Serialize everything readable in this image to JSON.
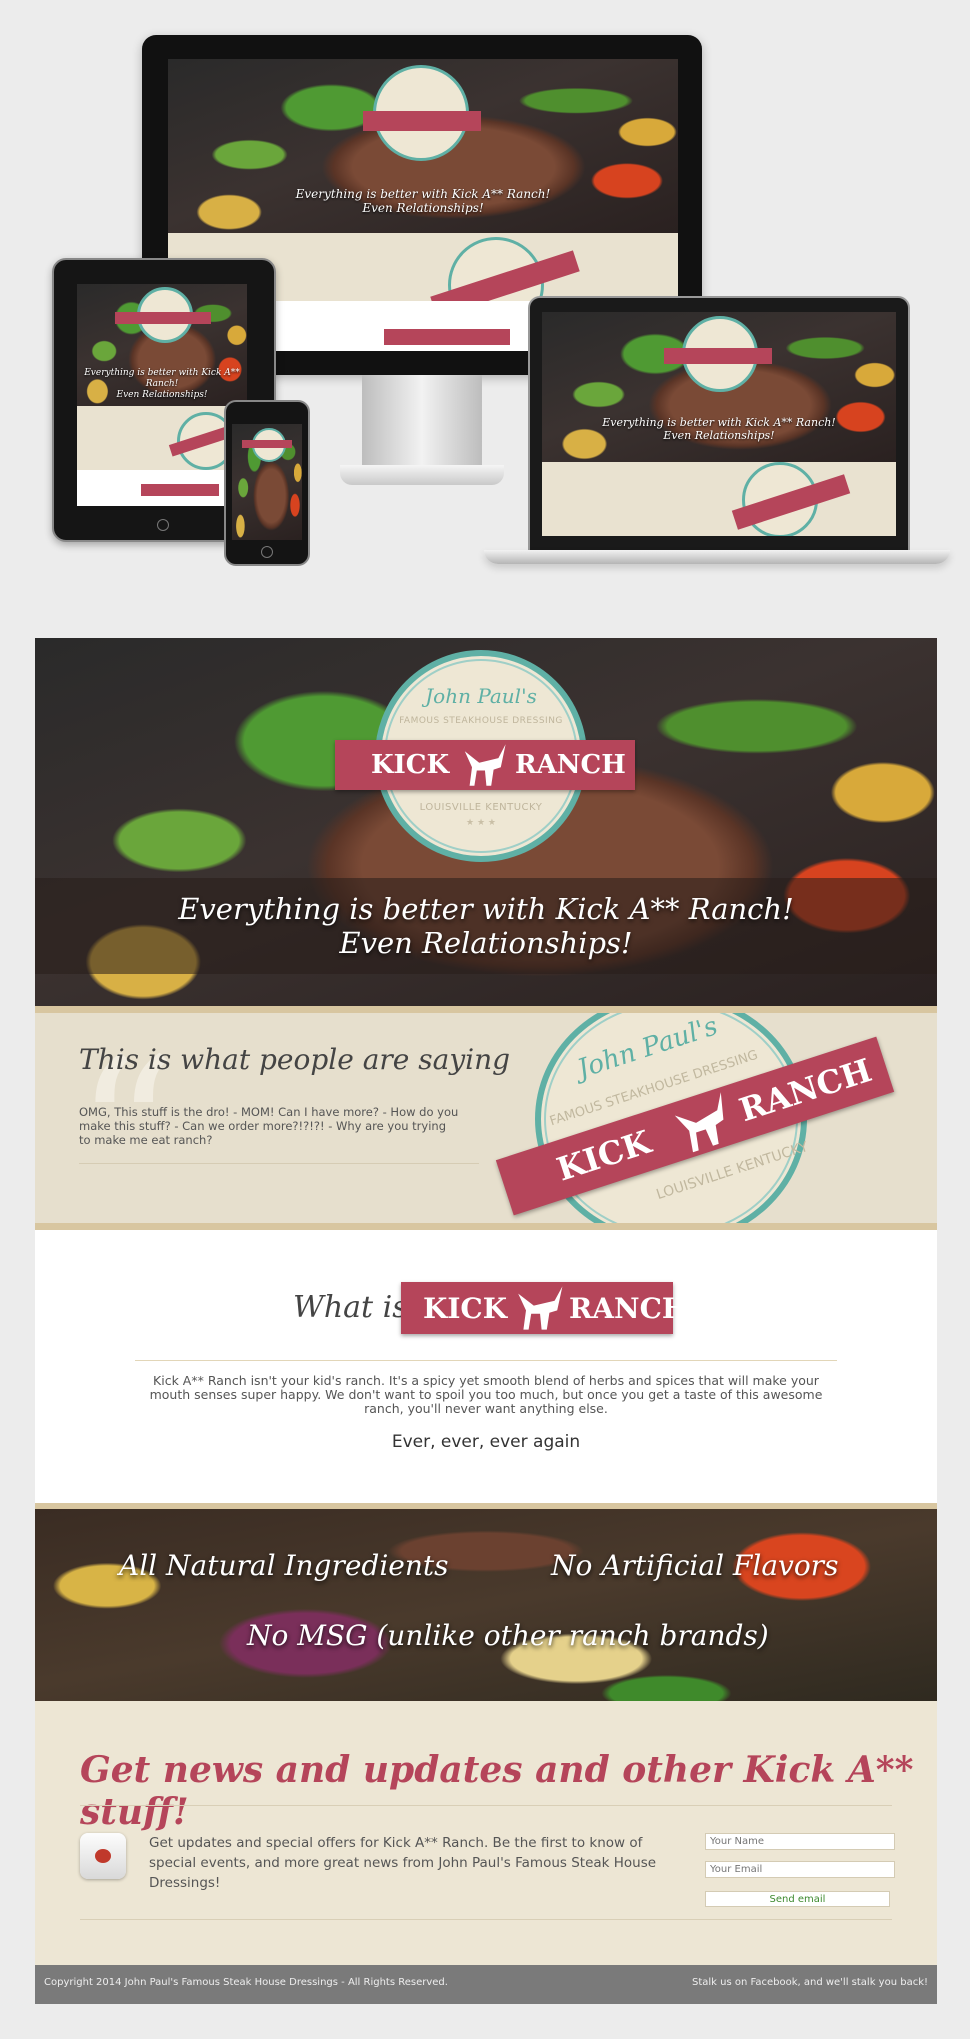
{
  "hero": {
    "logo_top": "John Paul's",
    "logo_sub": "FAMOUS STEAKHOUSE DRESSING",
    "brand_left": "KICK",
    "brand_right": "RANCH",
    "location": "LOUISVILLE KENTUCKY",
    "stars": "★ ★ ★",
    "tagline_line1": "Everything is better with Kick A** Ranch!",
    "tagline_line2": "Even Relationships!"
  },
  "testimonials": {
    "heading": "This is what people are saying",
    "text": "OMG, This stuff is the dro! - MOM! Can I have more? - How do you make this stuff? - Can we order more?!?!?! - Why are you trying to make me eat ranch?"
  },
  "what_is": {
    "prefix": "What is",
    "description": "Kick A** Ranch isn't your kid's ranch. It's a spicy yet smooth blend of herbs and spices that will make your mouth senses super happy. We don't want to spoil you too much, but once you get a taste of this awesome ranch, you'll never want anything else.",
    "ever": "Ever, ever, ever again"
  },
  "features": {
    "f1": "All Natural Ingredients",
    "f2": "No Artificial Flavors",
    "f3": "No MSG (unlike other ranch brands)"
  },
  "newsletter": {
    "heading": "Get news and updates and other Kick A** stuff!",
    "text": "Get updates and special offers for Kick A** Ranch. Be the first to know of special events, and more great news from John Paul's Famous Steak House Dressings!",
    "name_placeholder": "Your Name",
    "email_placeholder": "Your Email",
    "send_label": "Send email"
  },
  "footer": {
    "copyright": "Copyright 2014 John Paul's Famous Steak House Dressings - All Rights Reserved.",
    "social": "Stalk us on Facebook, and we'll stalk you back!"
  },
  "colors": {
    "brand_red": "#b5455a",
    "teal": "#5fb0a5",
    "cream": "#e6dfcd",
    "footer": "#7a7a7a"
  }
}
